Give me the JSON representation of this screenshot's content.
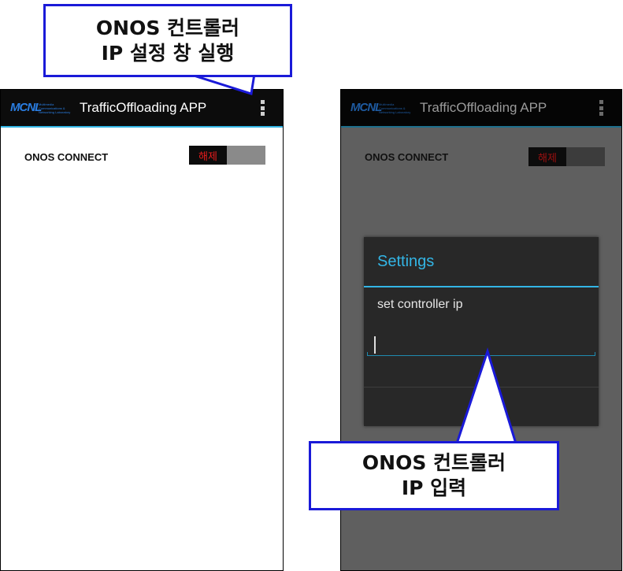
{
  "colors": {
    "accent": "#33b5e5",
    "callout_border": "#1a1ad8",
    "toggle_text": "#e81c1c"
  },
  "left_screen": {
    "logo": {
      "text": "MCNL",
      "subtitle": "Multimedia Communications & Networking Laboratory"
    },
    "app_title": "TrafficOffloading APP",
    "overflow_icon": "more-vert-icon",
    "connect_label": "ONOS CONNECT",
    "toggle": {
      "label": "해제",
      "state": "off"
    }
  },
  "right_screen": {
    "logo": {
      "text": "MCNL",
      "subtitle": "Multimedia Communications & Networking Laboratory"
    },
    "app_title": "TrafficOffloading APP",
    "overflow_icon": "more-vert-icon",
    "connect_label": "ONOS CONNECT",
    "toggle": {
      "label": "해제",
      "state": "off"
    },
    "dialog": {
      "title": "Settings",
      "message": "set controller ip",
      "input_value": ""
    }
  },
  "callouts": {
    "top": {
      "line1": "ONOS 컨트롤러",
      "line2": "IP 설정 창 실행"
    },
    "bottom": {
      "line1": "ONOS 컨트롤러",
      "line2": "IP 입력"
    }
  }
}
